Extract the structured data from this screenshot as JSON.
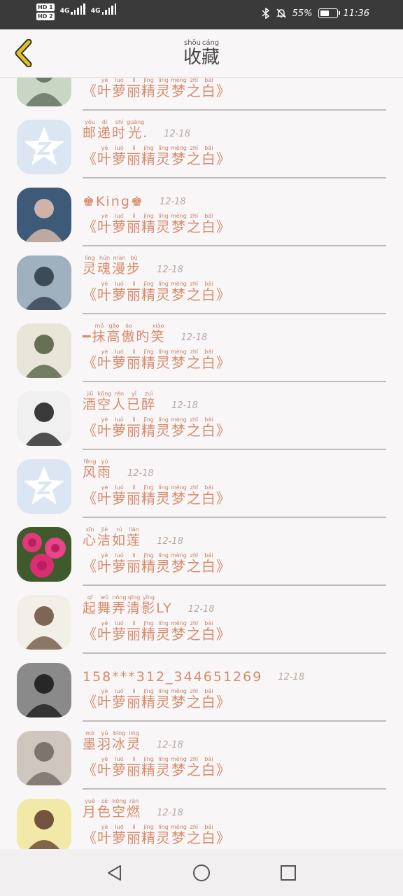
{
  "status_bar": {
    "hd1": "HD 1",
    "hd2": "HD 2",
    "net1": "4G",
    "net2": "4G",
    "battery_percent": "55%",
    "battery_level": 0.55,
    "time": "11:36",
    "icons": [
      "bluetooth-icon",
      "bell-muted-icon",
      "battery-icon"
    ]
  },
  "header": {
    "title_chars": [
      {
        "char": "收",
        "pinyin": "shōu"
      },
      {
        "char": "藏",
        "pinyin": "cáng"
      }
    ],
    "back_icon": "chevron-left-icon",
    "accent": "#e3c21f"
  },
  "list": {
    "subtitle_chars": [
      {
        "t": "《",
        "p": ""
      },
      {
        "t": "叶",
        "p": "yè"
      },
      {
        "t": "萝",
        "p": "luó"
      },
      {
        "t": "丽",
        "p": "lì"
      },
      {
        "t": "精",
        "p": "jīng"
      },
      {
        "t": "灵",
        "p": "líng"
      },
      {
        "t": "梦",
        "p": "mèng"
      },
      {
        "t": "之",
        "p": "zhī"
      },
      {
        "t": "白",
        "p": "bái"
      },
      {
        "t": "》",
        "p": ""
      }
    ],
    "items": [
      {
        "name": [],
        "date": "",
        "avatar": "photo"
      },
      {
        "name": [
          {
            "t": "邮",
            "p": "yóu"
          },
          {
            "t": "递",
            "p": "dì"
          },
          {
            "t": "时",
            "p": "shí"
          },
          {
            "t": "光",
            "p": "guāng"
          },
          {
            "t": ".",
            "p": ""
          }
        ],
        "date": "12-18",
        "avatar": "qq-star"
      },
      {
        "name": [
          {
            "t": "♚King♚",
            "p": ""
          }
        ],
        "date": "12-18",
        "avatar": "photo"
      },
      {
        "name": [
          {
            "t": "灵",
            "p": "líng"
          },
          {
            "t": "魂",
            "p": "hún"
          },
          {
            "t": "漫",
            "p": "màn"
          },
          {
            "t": "步",
            "p": "bù"
          }
        ],
        "date": "12-18",
        "avatar": "photo"
      },
      {
        "name": [
          {
            "t": "━",
            "p": ""
          },
          {
            "t": "抹",
            "p": "mǒ"
          },
          {
            "t": "高",
            "p": "gāo"
          },
          {
            "t": "傲",
            "p": "ào"
          },
          {
            "t": "旳",
            "p": ""
          },
          {
            "t": "笑",
            "p": "xiào"
          }
        ],
        "date": "12-18",
        "avatar": "photo"
      },
      {
        "name": [
          {
            "t": "酒",
            "p": "jiǔ"
          },
          {
            "t": "空",
            "p": "kōng"
          },
          {
            "t": "人",
            "p": "rén"
          },
          {
            "t": "已",
            "p": "yǐ"
          },
          {
            "t": "醉",
            "p": "zuì"
          }
        ],
        "date": "12-18",
        "avatar": "photo"
      },
      {
        "name": [
          {
            "t": "风",
            "p": "fēng"
          },
          {
            "t": "雨",
            "p": "yǔ"
          }
        ],
        "date": "12-18",
        "avatar": "qq-star"
      },
      {
        "name": [
          {
            "t": "心",
            "p": "xīn"
          },
          {
            "t": "洁",
            "p": "jié"
          },
          {
            "t": "如",
            "p": "rú"
          },
          {
            "t": "莲",
            "p": "lián"
          }
        ],
        "date": "12-18",
        "avatar": "roses"
      },
      {
        "name": [
          {
            "t": "起",
            "p": "qǐ"
          },
          {
            "t": "舞",
            "p": "wǔ"
          },
          {
            "t": "弄",
            "p": "nòng"
          },
          {
            "t": "清",
            "p": "qīng"
          },
          {
            "t": "影",
            "p": "yǐng"
          },
          {
            "t": "LY",
            "p": ""
          }
        ],
        "date": "12-18",
        "avatar": "photo"
      },
      {
        "name": [
          {
            "t": "158***312_344651269",
            "p": ""
          }
        ],
        "date": "12-18",
        "avatar": "photo"
      },
      {
        "name": [
          {
            "t": "墨",
            "p": "mò"
          },
          {
            "t": "羽",
            "p": "yǔ"
          },
          {
            "t": "冰",
            "p": "bīng"
          },
          {
            "t": "灵",
            "p": "líng"
          }
        ],
        "date": "12-18",
        "avatar": "photo"
      },
      {
        "name": [
          {
            "t": "月",
            "p": "yuè"
          },
          {
            "t": "色",
            "p": "sè"
          },
          {
            "t": "空",
            "p": "kōng"
          },
          {
            "t": "燃",
            "p": "rán"
          }
        ],
        "date": "12-18",
        "avatar": "photo"
      }
    ]
  },
  "navbar": {
    "icons": [
      "back-triangle-icon",
      "home-circle-icon",
      "recents-square-icon"
    ]
  }
}
